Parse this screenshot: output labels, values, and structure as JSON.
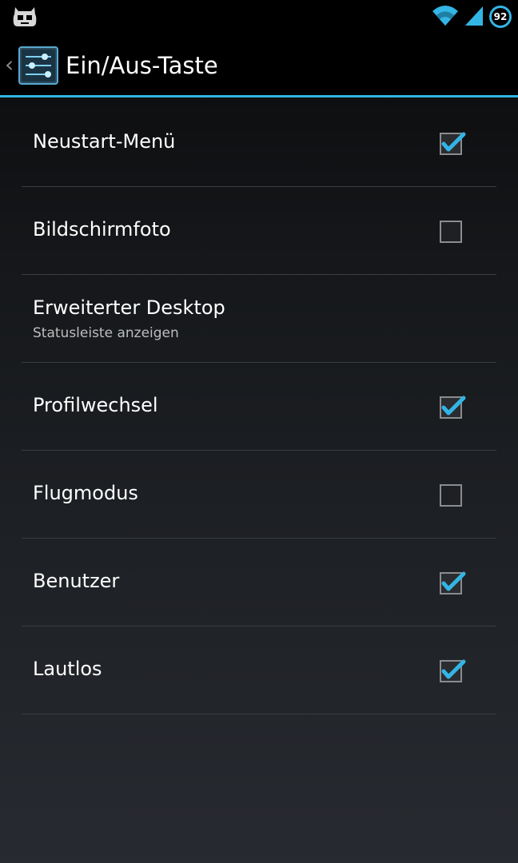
{
  "status_bar": {
    "battery_level": "92",
    "icons": [
      "cyanogenmod-mascot-icon",
      "wifi-icon",
      "signal-icon",
      "battery-icon"
    ]
  },
  "action_bar": {
    "title": "Ein/Aus-Taste",
    "app_icon": "settings-sliders-icon"
  },
  "colors": {
    "accent": "#33b5e5",
    "background": "#1d2024",
    "divider": "#3a3c40"
  },
  "preferences": [
    {
      "label": "Neustart-Menü",
      "checked": true
    },
    {
      "label": "Bildschirmfoto",
      "checked": false
    },
    {
      "label": "Erweiterter Desktop",
      "summary": "Statusleiste anzeigen"
    },
    {
      "label": "Profilwechsel",
      "checked": true
    },
    {
      "label": "Flugmodus",
      "checked": false
    },
    {
      "label": "Benutzer",
      "checked": true
    },
    {
      "label": "Lautlos",
      "checked": true
    }
  ]
}
